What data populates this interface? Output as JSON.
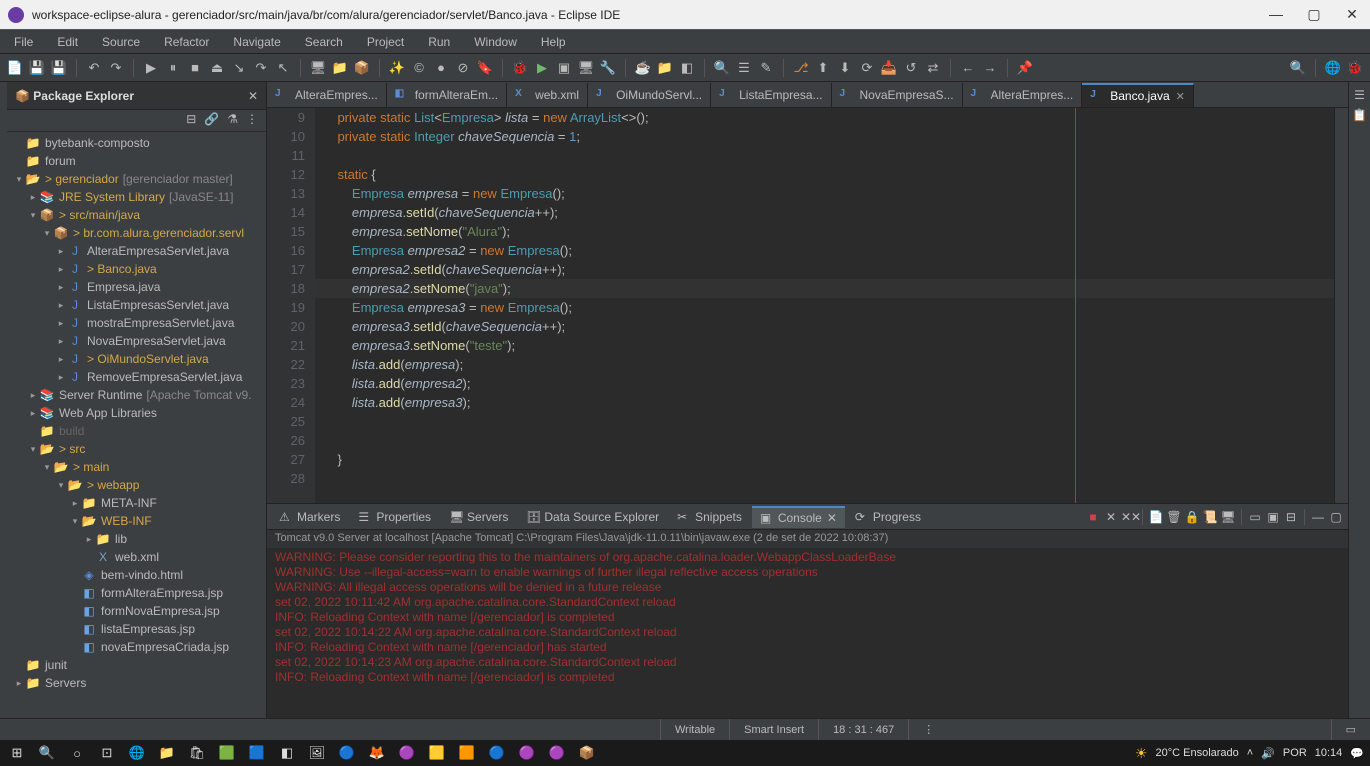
{
  "window": {
    "title": "workspace-eclipse-alura - gerenciador/src/main/java/br/com/alura/gerenciador/servlet/Banco.java - Eclipse IDE"
  },
  "menu": [
    "File",
    "Edit",
    "Source",
    "Refactor",
    "Navigate",
    "Search",
    "Project",
    "Run",
    "Window",
    "Help"
  ],
  "package_explorer": {
    "title": "Package Explorer",
    "items": [
      {
        "depth": 0,
        "tw": "",
        "ico": "ico-folder",
        "label": "bytebank-composto"
      },
      {
        "depth": 0,
        "tw": "",
        "ico": "ico-folder",
        "label": "forum"
      },
      {
        "depth": 0,
        "tw": "▾",
        "ico": "ico-pfolder",
        "label": "> gerenciador",
        "decor": "[gerenciador master]",
        "accent": true
      },
      {
        "depth": 1,
        "tw": "▸",
        "ico": "ico-lib",
        "label": "JRE System Library",
        "decor": "[JavaSE-11]",
        "accent": true
      },
      {
        "depth": 1,
        "tw": "▾",
        "ico": "ico-pkg",
        "label": "> src/main/java",
        "accent": true
      },
      {
        "depth": 2,
        "tw": "▾",
        "ico": "ico-pkg",
        "label": "> br.com.alura.gerenciador.servl",
        "accent": true
      },
      {
        "depth": 3,
        "tw": "▸",
        "ico": "ico-java",
        "label": "AlteraEmpresaServlet.java"
      },
      {
        "depth": 3,
        "tw": "▸",
        "ico": "ico-java",
        "label": "> Banco.java",
        "accent": true
      },
      {
        "depth": 3,
        "tw": "▸",
        "ico": "ico-java",
        "label": "Empresa.java"
      },
      {
        "depth": 3,
        "tw": "▸",
        "ico": "ico-java",
        "label": "ListaEmpresasServlet.java"
      },
      {
        "depth": 3,
        "tw": "▸",
        "ico": "ico-java",
        "label": "mostraEmpresaServlet.java"
      },
      {
        "depth": 3,
        "tw": "▸",
        "ico": "ico-java",
        "label": "NovaEmpresaServlet.java"
      },
      {
        "depth": 3,
        "tw": "▸",
        "ico": "ico-java",
        "label": "> OiMundoServlet.java",
        "accent": true
      },
      {
        "depth": 3,
        "tw": "▸",
        "ico": "ico-java",
        "label": "RemoveEmpresaServlet.java"
      },
      {
        "depth": 1,
        "tw": "▸",
        "ico": "ico-lib",
        "label": "Server Runtime",
        "decor": "[Apache Tomcat v9."
      },
      {
        "depth": 1,
        "tw": "▸",
        "ico": "ico-lib",
        "label": "Web App Libraries"
      },
      {
        "depth": 1,
        "tw": "",
        "ico": "ico-folder",
        "label": "build",
        "dim": true
      },
      {
        "depth": 1,
        "tw": "▾",
        "ico": "ico-pfolder",
        "label": "> src",
        "accent": true
      },
      {
        "depth": 2,
        "tw": "▾",
        "ico": "ico-pfolder",
        "label": "> main",
        "accent": true
      },
      {
        "depth": 3,
        "tw": "▾",
        "ico": "ico-pfolder",
        "label": "> webapp",
        "accent": true
      },
      {
        "depth": 4,
        "tw": "▸",
        "ico": "ico-folder",
        "label": "META-INF"
      },
      {
        "depth": 4,
        "tw": "▾",
        "ico": "ico-pfolder",
        "label": "WEB-INF",
        "accent": true
      },
      {
        "depth": 5,
        "tw": "▸",
        "ico": "ico-folder",
        "label": "lib"
      },
      {
        "depth": 5,
        "tw": "",
        "ico": "ico-xml",
        "label": "web.xml"
      },
      {
        "depth": 4,
        "tw": "",
        "ico": "ico-html",
        "label": "bem-vindo.html"
      },
      {
        "depth": 4,
        "tw": "",
        "ico": "ico-jsp",
        "label": "formAlteraEmpresa.jsp"
      },
      {
        "depth": 4,
        "tw": "",
        "ico": "ico-jsp",
        "label": "formNovaEmpresa.jsp"
      },
      {
        "depth": 4,
        "tw": "",
        "ico": "ico-jsp",
        "label": "listaEmpresas.jsp"
      },
      {
        "depth": 4,
        "tw": "",
        "ico": "ico-jsp",
        "label": "novaEmpresaCriada.jsp"
      },
      {
        "depth": 0,
        "tw": "",
        "ico": "ico-folder",
        "label": "junit"
      },
      {
        "depth": 0,
        "tw": "▸",
        "ico": "ico-folder",
        "label": "Servers"
      }
    ]
  },
  "editor_tabs": [
    {
      "label": "AlteraEmpres...",
      "ico": "J"
    },
    {
      "label": "formAlteraEm...",
      "ico": "◧"
    },
    {
      "label": "web.xml",
      "ico": "X"
    },
    {
      "label": "OiMundoServl...",
      "ico": "J"
    },
    {
      "label": "ListaEmpresa...",
      "ico": "J"
    },
    {
      "label": "NovaEmpresaS...",
      "ico": "J"
    },
    {
      "label": "AlteraEmpres...",
      "ico": "J"
    },
    {
      "label": "Banco.java",
      "ico": "J",
      "active": true
    }
  ],
  "code": {
    "start": 9,
    "current": 18,
    "lines": [
      {
        "html": "    <span class='kw'>private static</span> <span class='type'>List</span>&lt;<span class='type'>Empresa</span>&gt; <span class='ident'>lista</span> = <span class='kw'>new</span> <span class='type'>ArrayList</span>&lt;&gt;();"
      },
      {
        "html": "    <span class='kw'>private static</span> <span class='type'>Integer</span> <span class='ident'>chaveSequencia</span> = <span class='num'>1</span>;"
      },
      {
        "html": ""
      },
      {
        "html": "    <span class='kw'>static</span> {"
      },
      {
        "html": "        <span class='type'>Empresa</span> <span class='ident'>empresa</span> = <span class='kw'>new</span> <span class='type'>Empresa</span>();"
      },
      {
        "html": "        <span class='ident'>empresa</span>.<span class='method'>setId</span>(<span class='ident'>chaveSequencia</span>++);"
      },
      {
        "html": "        <span class='ident'>empresa</span>.<span class='method'>setNome</span>(<span class='str'>\"Alura\"</span>);"
      },
      {
        "html": "        <span class='type'>Empresa</span> <span class='ident'>empresa2</span> = <span class='kw'>new</span> <span class='type'>Empresa</span>();"
      },
      {
        "html": "        <span class='ident'>empresa2</span>.<span class='method'>setId</span>(<span class='ident'>chaveSequencia</span>++);"
      },
      {
        "html": "        <span class='ident'>empresa2</span>.<span class='method'>setNome</span>(<span class='str'>\"java\"</span>);"
      },
      {
        "html": "        <span class='type'>Empresa</span> <span class='ident'>empresa3</span> = <span class='kw'>new</span> <span class='type'>Empresa</span>();"
      },
      {
        "html": "        <span class='ident'>empresa3</span>.<span class='method'>setId</span>(<span class='ident'>chaveSequencia</span>++);"
      },
      {
        "html": "        <span class='ident'>empresa3</span>.<span class='method'>setNome</span>(<span class='str'>\"teste\"</span>);"
      },
      {
        "html": "        <span class='ident'>lista</span>.<span class='method'>add</span>(<span class='ident'>empresa</span>);"
      },
      {
        "html": "        <span class='ident'>lista</span>.<span class='method'>add</span>(<span class='ident'>empresa2</span>);"
      },
      {
        "html": "        <span class='ident'>lista</span>.<span class='method'>add</span>(<span class='ident'>empresa3</span>);"
      },
      {
        "html": ""
      },
      {
        "html": ""
      },
      {
        "html": "    }"
      },
      {
        "html": ""
      }
    ]
  },
  "bottom_tabs": [
    "Markers",
    "Properties",
    "Servers",
    "Data Source Explorer",
    "Snippets",
    "Console",
    "Progress"
  ],
  "bottom_active": 5,
  "console_header": "Tomcat v9.0 Server at localhost [Apache Tomcat] C:\\Program Files\\Java\\jdk-11.0.11\\bin\\javaw.exe  (2 de set de 2022 10:08:37)",
  "console_lines": [
    {
      "cls": "warn",
      "t": "WARNING: Please consider reporting this to the maintainers of org.apache.catalina.loader.WebappClassLoaderBase"
    },
    {
      "cls": "warn",
      "t": "WARNING: Use --illegal-access=warn to enable warnings of further illegal reflective access operations"
    },
    {
      "cls": "warn",
      "t": "WARNING: All illegal access operations will be denied in a future release"
    },
    {
      "cls": "warn",
      "t": "set 02, 2022 10:11:42 AM org.apache.catalina.core.StandardContext reload"
    },
    {
      "cls": "warn",
      "t": "INFO: Reloading Context with name [/gerenciador] is completed"
    },
    {
      "cls": "warn",
      "t": "set 02, 2022 10:14:22 AM org.apache.catalina.core.StandardContext reload"
    },
    {
      "cls": "warn",
      "t": "INFO: Reloading Context with name [/gerenciador] has started"
    },
    {
      "cls": "warn",
      "t": "set 02, 2022 10:14:23 AM org.apache.catalina.core.StandardContext reload"
    },
    {
      "cls": "warn",
      "t": "INFO: Reloading Context with name [/gerenciador] is completed"
    }
  ],
  "status": {
    "writable": "Writable",
    "insert": "Smart Insert",
    "pos": "18 : 31 : 467"
  },
  "taskbar": {
    "weather": "20°C  Ensolarado",
    "lang": "POR",
    "time": "10:14"
  }
}
